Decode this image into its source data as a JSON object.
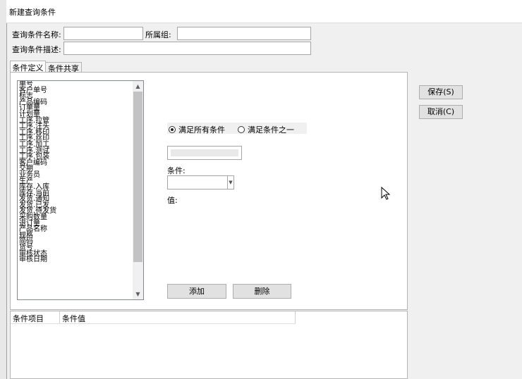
{
  "window": {
    "title": "新建查询条件"
  },
  "form": {
    "name_label": "查询条件名称:",
    "name_value": "",
    "group_label": "所属组:",
    "group_value": "",
    "desc_label": "查询条件描述:",
    "desc_value": ""
  },
  "tabs": [
    {
      "label": "条件定义",
      "active": true
    },
    {
      "label": "条件共享",
      "active": false
    }
  ],
  "field_list": {
    "items": [
      "单号",
      "客户单号",
      "标志",
      "产品编码",
      "订单量",
      "计划量",
      "工序.拉管",
      "工序.注头",
      "工序.移印",
      "工序.丝印",
      "工序.加工",
      "工序.测试",
      "工序.包装",
      "客户编码",
      "交期",
      "业务员",
      "生产",
      "库存.入库",
      "库存.当前",
      "发货.通知",
      "发货.已发",
      "发货.待发货",
      "采购数量",
      "退订量",
      "产品名称",
      "规格",
      "简码",
      "货号",
      "审核状态",
      "审核日期"
    ]
  },
  "match_mode": {
    "all_label": "满足所有条件",
    "any_label": "满足条件之一",
    "selected": "all"
  },
  "condition": {
    "value_text": "",
    "condition_label": "条件:",
    "condition_selected": "",
    "value_label": "值:"
  },
  "buttons": {
    "add": "添加",
    "delete": "删除",
    "save": "保存(S)",
    "cancel": "取消(C)"
  },
  "result_grid": {
    "columns": [
      "条件项目",
      "条件值"
    ],
    "rows": []
  },
  "colors": {
    "window_bg": "#f0f0f0",
    "panel_bg": "#ffffff",
    "border": "#b4b4b4",
    "scroll_thumb": "#c2c2c2"
  },
  "icons": {
    "list_scroll_up": "chevron-up-icon",
    "list_scroll_down": "chevron-down-icon",
    "combo_dropdown": "chevron-down-icon",
    "mouse_cursor": "pointer-cursor-icon"
  }
}
